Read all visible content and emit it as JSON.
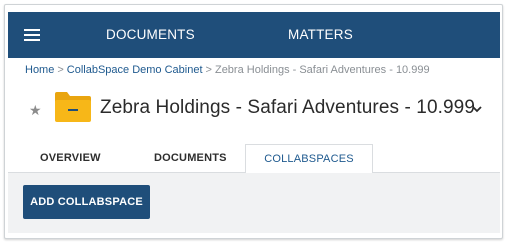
{
  "nav": {
    "menu_icon": "hamburger-menu-icon",
    "items": [
      {
        "label": "DOCUMENTS"
      },
      {
        "label": "MATTERS"
      }
    ]
  },
  "breadcrumb": {
    "items": [
      "Home",
      "CollabSpace Demo Cabinet",
      "Zebra Holdings - Safari Adventures - 10.999"
    ],
    "separator": ">"
  },
  "header": {
    "favorite_icon": "star-icon",
    "type_icon": "folder-icon",
    "title": "Zebra Holdings - Safari Adventures - 10.999",
    "expand_icon": "chevron-down-icon"
  },
  "tabs": [
    {
      "label": "OVERVIEW"
    },
    {
      "label": "DOCUMENTS"
    },
    {
      "label": "COLLABSPACES",
      "active": true
    }
  ],
  "content": {
    "add_button_label": "ADD COLLABSPACE"
  },
  "colors": {
    "primary": "#1f4e7a",
    "link": "#1f5a8f",
    "folder_yellow": "#f7b718",
    "content_bg": "#f1f2f3"
  }
}
